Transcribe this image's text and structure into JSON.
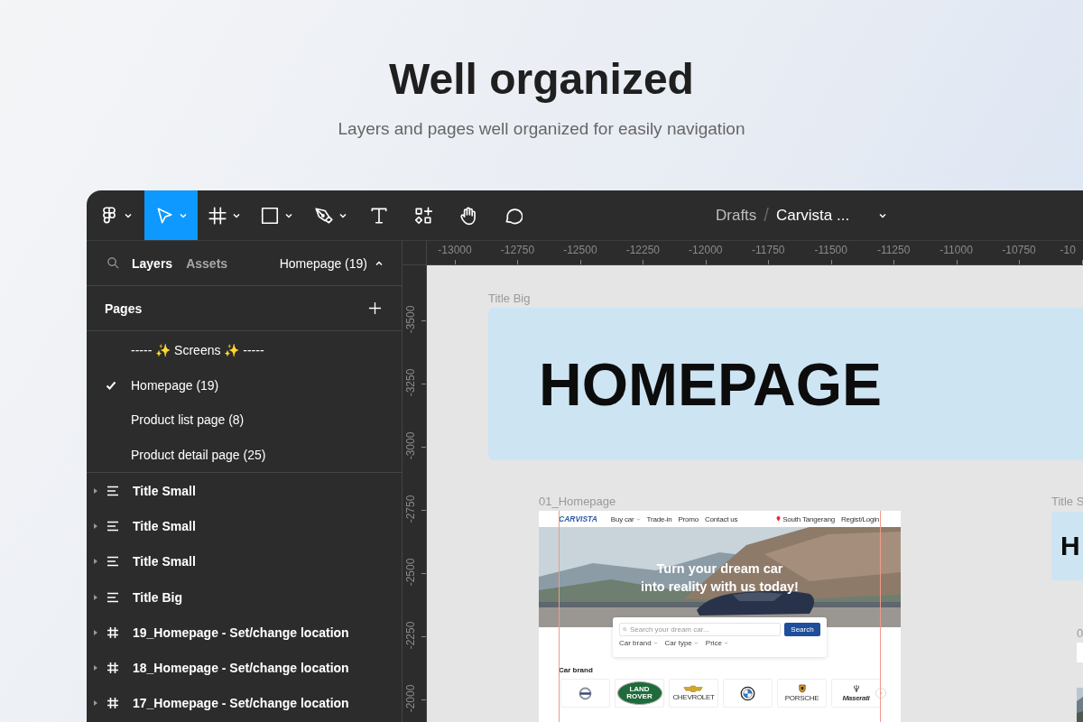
{
  "header": {
    "title": "Well organized",
    "subtitle": "Layers and pages well organized for easily navigation"
  },
  "toolbar": {
    "tools": [
      {
        "kind": "logo",
        "selected": false,
        "dropdown": true
      },
      {
        "kind": "move",
        "selected": true,
        "dropdown": true
      },
      {
        "kind": "frame",
        "selected": false,
        "dropdown": true
      },
      {
        "kind": "shape",
        "selected": false,
        "dropdown": true
      },
      {
        "kind": "pen",
        "selected": false,
        "dropdown": true
      },
      {
        "kind": "text",
        "selected": false,
        "dropdown": false
      },
      {
        "kind": "actions",
        "selected": false,
        "dropdown": false
      },
      {
        "kind": "hand",
        "selected": false,
        "dropdown": false
      },
      {
        "kind": "comment",
        "selected": false,
        "dropdown": false
      }
    ],
    "breadcrumb": {
      "folder": "Drafts",
      "separator": "/",
      "file": "Carvista ..."
    }
  },
  "left_panel": {
    "tabs": [
      {
        "label": "Layers",
        "selected": true
      },
      {
        "label": "Assets",
        "selected": false
      }
    ],
    "current_page": "Homepage (19)",
    "pages_title": "Pages",
    "pages": [
      {
        "label": "----- ✨ Screens ✨ -----",
        "selected": false
      },
      {
        "label": "Homepage (19)",
        "selected": true
      },
      {
        "label": "Product list page (8)",
        "selected": false
      },
      {
        "label": "Product detail page (25)",
        "selected": false
      }
    ],
    "layers": [
      {
        "kind": "text",
        "name": "Title Small"
      },
      {
        "kind": "text",
        "name": "Title Small"
      },
      {
        "kind": "text",
        "name": "Title Small"
      },
      {
        "kind": "text",
        "name": "Title Big"
      },
      {
        "kind": "frame",
        "name": "19_Homepage - Set/change location"
      },
      {
        "kind": "frame",
        "name": "18_Homepage - Set/change location"
      },
      {
        "kind": "frame",
        "name": "17_Homepage - Set/change location"
      }
    ]
  },
  "rulers": {
    "horizontal": [
      "-13000",
      "-12750",
      "-12500",
      "-12250",
      "-12000",
      "-11750",
      "-11500",
      "-11250",
      "-11000",
      "-10750",
      "-10"
    ],
    "vertical": [
      "-3500",
      "-3250",
      "-3000",
      "-2750",
      "-2500",
      "-2250",
      "-2000"
    ]
  },
  "canvas": {
    "title_big": {
      "label": "Title Big",
      "text": "HOMEPAGE"
    },
    "homepage_frame": {
      "label": "01_Homepage",
      "site": {
        "logo": "CARVISTA",
        "nav": [
          {
            "label": "Buy car",
            "dropdown": true
          },
          {
            "label": "Trade-in",
            "dropdown": false
          },
          {
            "label": "Promo",
            "dropdown": false
          },
          {
            "label": "Contact us",
            "dropdown": false
          }
        ],
        "location": "South Tangerang",
        "login": "Regist/Login",
        "headline": [
          "Turn your dream car",
          "into reality with us today!"
        ],
        "search_placeholder": "Search your dream car...",
        "search_button": "Search",
        "filters": [
          "Car brand",
          "Car type",
          "Price"
        ],
        "brand_heading": "Car brand",
        "brands": [
          {
            "kind": "ring"
          },
          {
            "kind": "oval",
            "wordmark": "LAND ROVER"
          },
          {
            "kind": "bowtie",
            "wordmark": "CHEVROLET"
          },
          {
            "kind": "roundel"
          },
          {
            "kind": "crest",
            "wordmark": "PORSCHE"
          },
          {
            "kind": "trident",
            "wordmark": "Maserati"
          }
        ]
      }
    },
    "partial_title": {
      "label": "Title S",
      "text": "H"
    },
    "partial_frame": {
      "label": "0"
    }
  }
}
